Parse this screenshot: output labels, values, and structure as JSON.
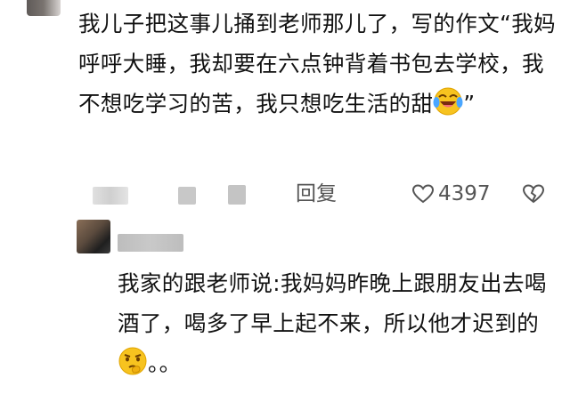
{
  "comment": {
    "text": "我儿子把这事儿捅到老师那儿了，写的作文“我妈呼呼大睡，我却要在六点钟背着书包去学校，我不想吃学习的苦，我只想吃生活的甜",
    "emoji_icon": "laughing-crying-emoji-icon",
    "closing_quote": "”"
  },
  "actions": {
    "reply_label": "回复",
    "like_count": "4397",
    "like_icon": "heart-outline-icon",
    "dislike_icon": "broken-heart-icon"
  },
  "reply": {
    "text": "我家的跟老师说:我妈妈昨晚上跟朋友出去喝酒了，喝多了早上起不来，所以他才迟到的",
    "emoji_icon": "thinking-emoji-icon",
    "trailing": "。。"
  }
}
